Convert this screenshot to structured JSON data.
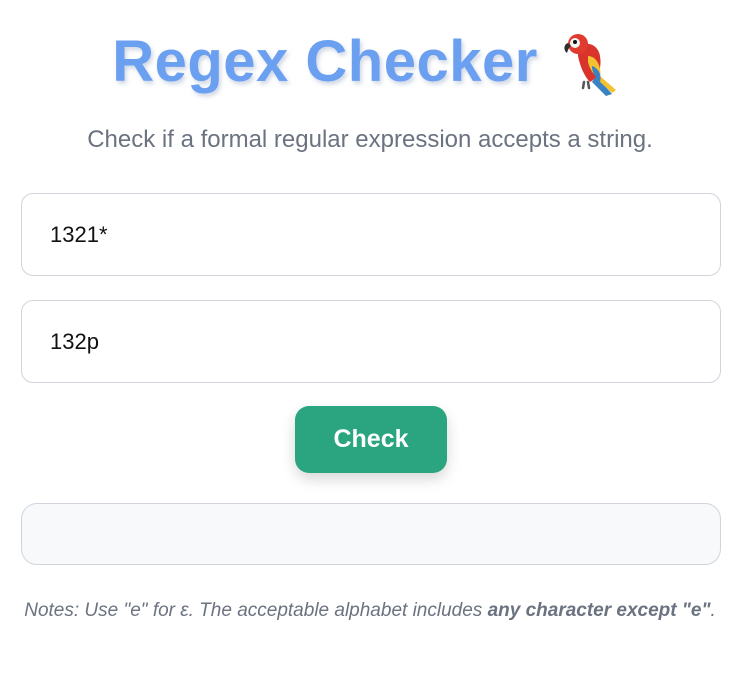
{
  "header": {
    "title": "Regex Checker",
    "icon": "parrot-icon"
  },
  "subtitle": "Check if a formal regular expression accepts a string.",
  "inputs": {
    "regex_value": "1321*",
    "string_value": "132p"
  },
  "button": {
    "check_label": "Check"
  },
  "result": {
    "text": ""
  },
  "notes": {
    "prefix": "Notes: Use \"e\" for ε. The acceptable alphabet includes ",
    "emphasis": "any character except \"e\"",
    "suffix": "."
  },
  "colors": {
    "title": "#6b9ff0",
    "button": "#2ba57f",
    "muted_text": "#6b7280",
    "border": "#d1d5db"
  }
}
